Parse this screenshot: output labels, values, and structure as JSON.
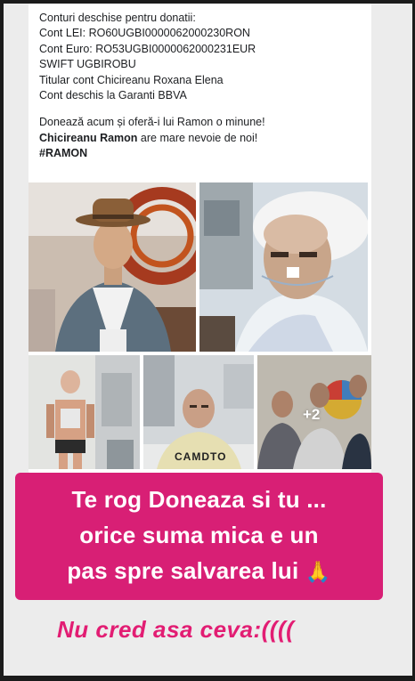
{
  "post": {
    "accounts_heading": "Conturi deschise pentru donatii:",
    "cont_lei": "Cont LEI:    RO60UGBI0000062000230RON",
    "cont_euro": "Cont Euro:  RO53UGBI0000062000231EUR",
    "swift": "SWIFT UGBIROBU",
    "titular": "Titular cont Chicireanu Roxana Elena",
    "bank": "Cont deschis la Garanti BBVA",
    "appeal": "Donează acum și oferă-i lui Ramon o minune!",
    "name_bold": "Chicireanu Ramon",
    "name_rest": " are mare nevoie de noi!",
    "hashtag": "#RAMON",
    "photos_more": "+2",
    "shirt_text": "CAMDTO"
  },
  "banner": {
    "line1": "Te rog Doneaza si tu ...",
    "line2": "orice suma mica e un",
    "line3": "pas spre salvarea lui",
    "emoji": "🙏",
    "color": "#d81f75"
  },
  "caption": {
    "text": "Nu cred asa ceva:((((",
    "color": "#e21d73"
  }
}
